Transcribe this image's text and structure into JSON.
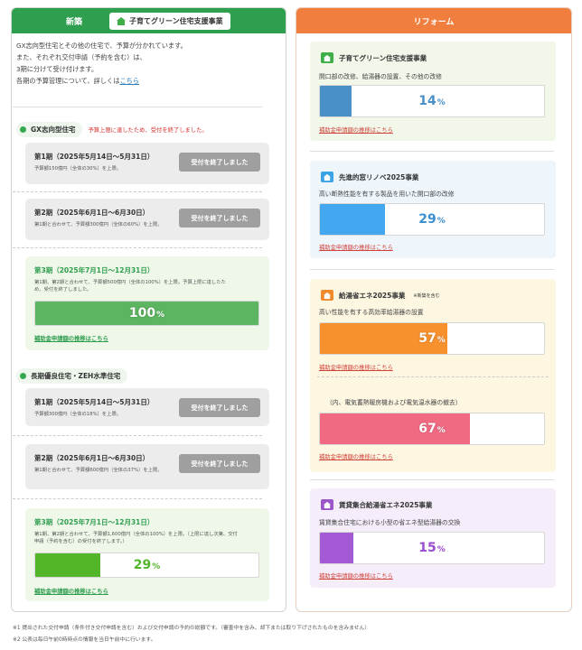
{
  "left": {
    "header": "新築",
    "tag": "子育てグリーン住宅支援事業",
    "intro": [
      "GX志向型住宅とその他の住宅で、予算が分かれています。",
      "また、それぞれ交付申請（予約を含む）は、",
      "3期に分けて受け付けます。",
      "各期の予算管理について、詳しくは"
    ],
    "intro_link": "こちら",
    "sections": [
      {
        "title": "GX志向型住宅",
        "notice": "予算上限に達したため、受付を終了しました。",
        "periods": [
          {
            "title": "第1期（2025年5月14日～5月31日）",
            "desc": "予算額150億円（全体の30%）を上限。",
            "status": "受付を終了しました"
          },
          {
            "title": "第2期（2025年6月1日～6月30日）",
            "desc": "第1期と合わせて、予算額300億円（全体の60%）を上限。",
            "status": "受付を終了しました"
          },
          {
            "title": "第3期（2025年7月1日～12月31日）",
            "desc": "第1期、第2期と合わせて、予算額500億円（全体の100%）を上限。予算上限に達したため、受付を終了しました。",
            "progress": 100,
            "progress_text": "100",
            "link": "補助金申請額の推移はこちら"
          }
        ]
      },
      {
        "title": "長期優良住宅・ZEH水準住宅",
        "notice": "",
        "periods": [
          {
            "title": "第1期（2025年5月14日～5月31日）",
            "desc": "予算額300億円（全体の18%）を上限。",
            "status": "受付を終了しました"
          },
          {
            "title": "第2期（2025年6月1日～6月30日）",
            "desc": "第1期と合わせて、予算額600億円（全体の37%）を上限。",
            "status": "受付を終了しました"
          },
          {
            "title": "第3期（2025年7月1日～12月31日）",
            "desc": "第1期、第2期と合わせて、予算額1,600億円（全体の100%）を上限。（上限に達し次第、交付申請（予約を含む）の受付を終了します。）",
            "progress": 29,
            "progress_text": "29",
            "link": "補助金申請額の推移はこちら"
          }
        ]
      }
    ]
  },
  "right": {
    "header": "リフォーム",
    "cards": [
      {
        "title": "子育てグリーン住宅支援事業",
        "desc": "開口部の改修、給湯器の設置、その他の改修",
        "progress": 14,
        "progress_text": "14",
        "link": "補助金申請額の推移はこちら",
        "color": "#4a90c8",
        "bg": "#f1f8ea",
        "icon_color": "#3fae48"
      },
      {
        "title": "先進的窓リノベ2025事業",
        "desc": "高い断熱性能を有する製品を用いた開口部の改修",
        "progress": 29,
        "progress_text": "29",
        "link": "補助金申請額の推移はこちら",
        "color": "#43a7f0",
        "bg": "#eef6fc",
        "icon_color": "#3aa3e6"
      },
      {
        "title": "給湯省エネ2025事業",
        "title_note": "※新築を含む",
        "desc": "高い性能を有する高効率給湯器の設置",
        "progress": 57,
        "progress_text": "57",
        "link": "補助金申請額の推移はこちら",
        "color": "#f7912e",
        "bg": "#fdf7e2",
        "icon_color": "#f08a2c",
        "sub": {
          "desc": "（内、電気蓄熱暖房機および電気温水器の撤去）",
          "progress": 67,
          "progress_text": "67",
          "link": "補助金申請額の推移はこちら",
          "color": "#f06a82"
        }
      },
      {
        "title": "賃貸集合給湯省エネ2025事業",
        "desc": "賃貸集合住宅における小型の省エネ型給湯器の交換",
        "progress": 15,
        "progress_text": "15",
        "link": "補助金申請額の推移はこちら",
        "color": "#a45ad4",
        "bg": "#f5eefa",
        "icon_color": "#9a55c8"
      }
    ]
  },
  "footnotes": [
    "※1 提出された交付申請（条件付き交付申請を含む）および交付申請の予約の総額です。（審査中を含み、却下または取り下げされたものを含みません）",
    "※2 公表は毎日午前0時時点の情報を当日午前中に行います。"
  ],
  "percent_sign": "%",
  "colors": {
    "green": "#2e9e4f",
    "orange": "#ef7e3f",
    "gx_full": "#5cb560",
    "zeh_fill": "#52b52a"
  }
}
